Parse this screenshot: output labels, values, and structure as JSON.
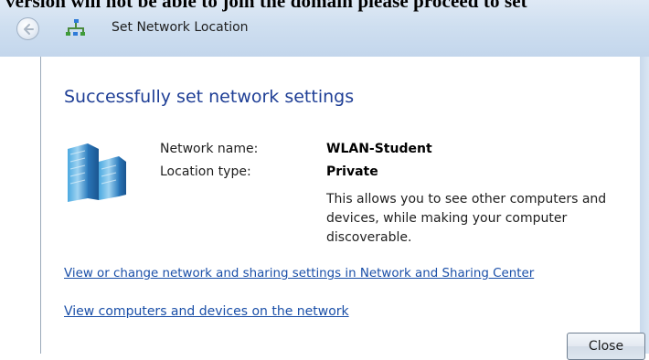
{
  "banner_text": "version will not be able to join the domain please proceed to set",
  "window": {
    "title": "Set Network Location",
    "back_icon": "back-arrow-icon",
    "app_icon": "network-icon"
  },
  "main": {
    "heading": "Successfully set network settings",
    "icon": "server-building-icon",
    "network_name_label": "Network name:",
    "network_name_value": "WLAN-Student",
    "location_type_label": "Location type:",
    "location_type_value": "Private",
    "description": "This allows you to see other computers and devices, while making your computer discoverable."
  },
  "links": {
    "sharing_center": "View or change network and sharing settings in Network and Sharing Center",
    "computers_devices": "View computers and devices on the network"
  },
  "buttons": {
    "close": "Close"
  },
  "colors": {
    "heading": "#1f3f96",
    "link": "#1a4fa8",
    "titlebar": "#cfdff0"
  }
}
